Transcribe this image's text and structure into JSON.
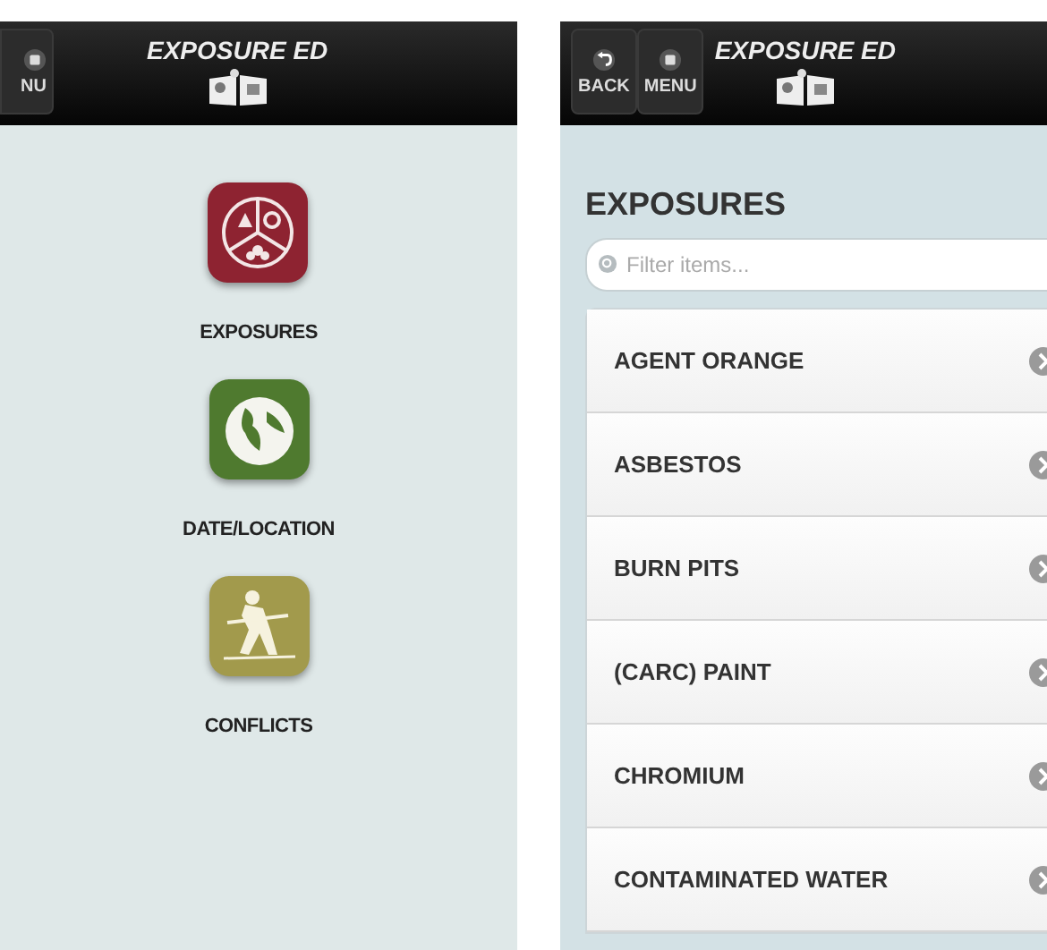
{
  "left_screen": {
    "header": {
      "buttons": [
        {
          "kind": "menu",
          "label": "NU"
        }
      ],
      "title": "EXPOSURE ED"
    },
    "menu_items": [
      {
        "kind": "exposures",
        "label": "EXPOSURES"
      },
      {
        "kind": "globe",
        "label": "DATE/LOCATION"
      },
      {
        "kind": "soldier",
        "label": "CONFLICTS"
      }
    ]
  },
  "right_screen": {
    "header": {
      "buttons": [
        {
          "kind": "back",
          "label": "BACK"
        },
        {
          "kind": "menu",
          "label": "MENU"
        }
      ],
      "title": "EXPOSURE ED"
    },
    "heading": "EXPOSURES",
    "filter": {
      "placeholder": "Filter items..."
    },
    "items": [
      {
        "label": "AGENT ORANGE"
      },
      {
        "label": "ASBESTOS"
      },
      {
        "label": "BURN PITS"
      },
      {
        "label": "(CARC) PAINT"
      },
      {
        "label": "CHROMIUM"
      },
      {
        "label": "CONTAMINATED WATER"
      }
    ]
  }
}
